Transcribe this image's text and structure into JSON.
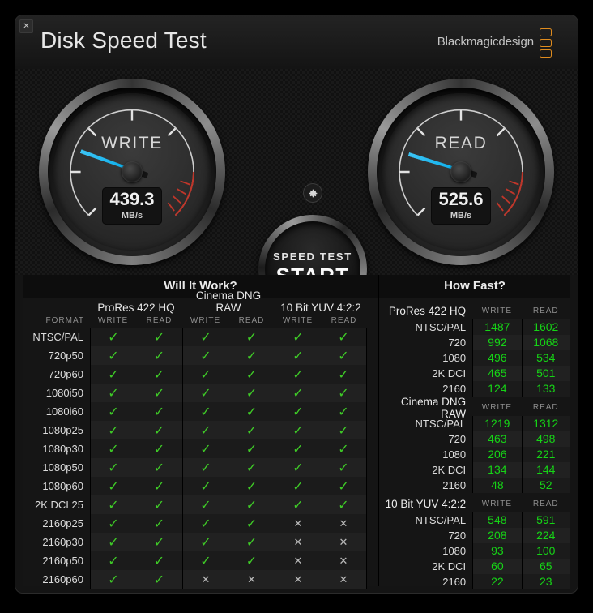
{
  "window": {
    "close_label": "✕",
    "title": "Disk Speed Test",
    "brand": "Blackmagicdesign"
  },
  "gauges": {
    "write": {
      "label": "WRITE",
      "value": "439.3",
      "unit": "MB/s",
      "needle_angle_deg": 200
    },
    "read": {
      "label": "READ",
      "value": "525.6",
      "unit": "MB/s",
      "needle_angle_deg": 197
    }
  },
  "controls": {
    "gear_icon": "gear-icon",
    "start_small": "SPEED TEST",
    "start_big": "START"
  },
  "will_it_work": {
    "title": "Will It Work?",
    "format_header": "FORMAT",
    "groups": [
      "ProRes 422 HQ",
      "Cinema DNG RAW",
      "10 Bit YUV 4:2:2"
    ],
    "sub_headers": [
      "WRITE",
      "READ"
    ],
    "ok_symbol": "✓",
    "no_symbol": "✕",
    "rows": [
      {
        "format": "NTSC/PAL",
        "marks": [
          true,
          true,
          true,
          true,
          true,
          true
        ]
      },
      {
        "format": "720p50",
        "marks": [
          true,
          true,
          true,
          true,
          true,
          true
        ]
      },
      {
        "format": "720p60",
        "marks": [
          true,
          true,
          true,
          true,
          true,
          true
        ]
      },
      {
        "format": "1080i50",
        "marks": [
          true,
          true,
          true,
          true,
          true,
          true
        ]
      },
      {
        "format": "1080i60",
        "marks": [
          true,
          true,
          true,
          true,
          true,
          true
        ]
      },
      {
        "format": "1080p25",
        "marks": [
          true,
          true,
          true,
          true,
          true,
          true
        ]
      },
      {
        "format": "1080p30",
        "marks": [
          true,
          true,
          true,
          true,
          true,
          true
        ]
      },
      {
        "format": "1080p50",
        "marks": [
          true,
          true,
          true,
          true,
          true,
          true
        ]
      },
      {
        "format": "1080p60",
        "marks": [
          true,
          true,
          true,
          true,
          true,
          true
        ]
      },
      {
        "format": "2K DCI 25",
        "marks": [
          true,
          true,
          true,
          true,
          true,
          true
        ]
      },
      {
        "format": "2160p25",
        "marks": [
          true,
          true,
          true,
          true,
          false,
          false
        ]
      },
      {
        "format": "2160p30",
        "marks": [
          true,
          true,
          true,
          true,
          false,
          false
        ]
      },
      {
        "format": "2160p50",
        "marks": [
          true,
          true,
          true,
          true,
          false,
          false
        ]
      },
      {
        "format": "2160p60",
        "marks": [
          true,
          true,
          false,
          false,
          false,
          false
        ]
      }
    ]
  },
  "how_fast": {
    "title": "How Fast?",
    "sub_headers": [
      "WRITE",
      "READ"
    ],
    "groups": [
      {
        "name": "ProRes 422 HQ",
        "rows": [
          {
            "label": "NTSC/PAL",
            "write": "1487",
            "read": "1602"
          },
          {
            "label": "720",
            "write": "992",
            "read": "1068"
          },
          {
            "label": "1080",
            "write": "496",
            "read": "534"
          },
          {
            "label": "2K DCI",
            "write": "465",
            "read": "501"
          },
          {
            "label": "2160",
            "write": "124",
            "read": "133"
          }
        ]
      },
      {
        "name": "Cinema DNG RAW",
        "rows": [
          {
            "label": "NTSC/PAL",
            "write": "1219",
            "read": "1312"
          },
          {
            "label": "720",
            "write": "463",
            "read": "498"
          },
          {
            "label": "1080",
            "write": "206",
            "read": "221"
          },
          {
            "label": "2K DCI",
            "write": "134",
            "read": "144"
          },
          {
            "label": "2160",
            "write": "48",
            "read": "52"
          }
        ]
      },
      {
        "name": "10 Bit YUV 4:2:2",
        "rows": [
          {
            "label": "NTSC/PAL",
            "write": "548",
            "read": "591"
          },
          {
            "label": "720",
            "write": "208",
            "read": "224"
          },
          {
            "label": "1080",
            "write": "93",
            "read": "100"
          },
          {
            "label": "2K DCI",
            "write": "60",
            "read": "65"
          },
          {
            "label": "2160",
            "write": "22",
            "read": "23"
          }
        ]
      }
    ]
  },
  "colors": {
    "ok_green": "#3fcc27",
    "value_green": "#16d416",
    "needle_blue": "#00a9e8",
    "redzone": "#c0362a",
    "brand_orange": "#e08c1e"
  }
}
